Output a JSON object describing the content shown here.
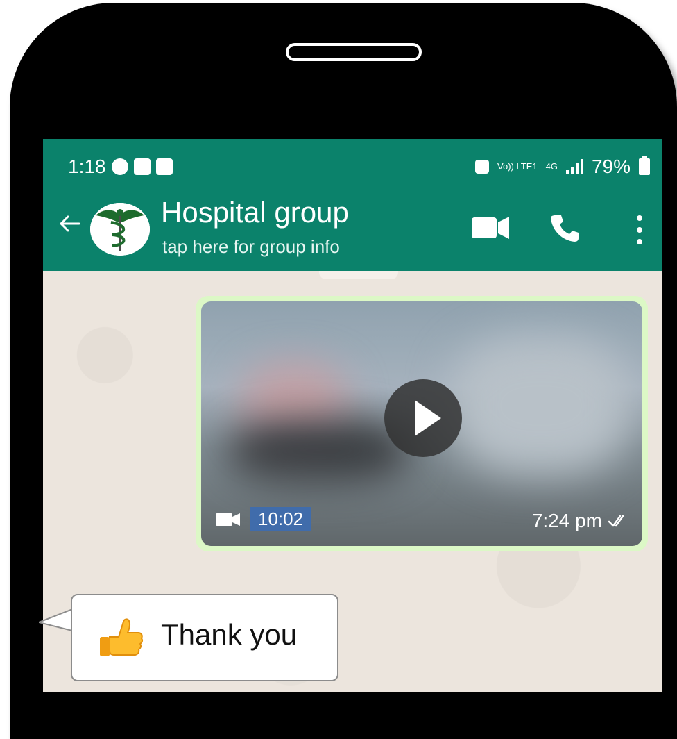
{
  "status_bar": {
    "time": "1:18",
    "network_label": "4G",
    "volte_label": "Vo)) LTE1",
    "battery": "79%"
  },
  "header": {
    "title": "Hospital group",
    "subtitle": "tap here for group info"
  },
  "video_message": {
    "duration": "10:02",
    "time": "7:24 pm"
  },
  "callout": {
    "text": "Thank you"
  },
  "colors": {
    "header_green": "#0b826b",
    "bubble_green": "#dcf8c6",
    "chat_bg": "#ece5dd"
  }
}
